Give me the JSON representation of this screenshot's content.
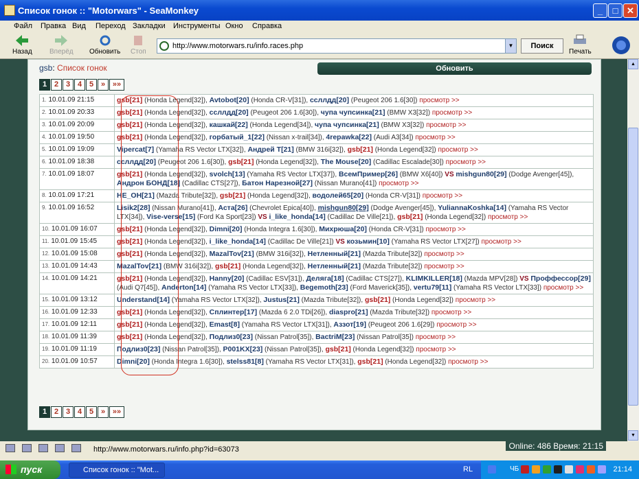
{
  "window": {
    "title": "Список гонок :: \"Motorwars\" - SeaMonkey",
    "buttons": [
      "_",
      "□",
      "✕"
    ]
  },
  "menu": [
    "Файл",
    "Правка",
    "Вид",
    "Переход",
    "Закладки",
    "Инструменты",
    "Окно",
    "Справка"
  ],
  "toolbar": {
    "back": "Назад",
    "forward": "Вперёд",
    "reload": "Обновить",
    "stop": "Стоп",
    "print": "Печать",
    "url": "http://www.motorwars.ru/info.races.php",
    "search": "Поиск"
  },
  "page": {
    "user": "gsb",
    "heading": "Список гонок",
    "refresh": "Обновить",
    "pager": [
      "1",
      "2",
      "3",
      "4",
      "5",
      "»",
      "»»"
    ],
    "view_label": "просмотр >>",
    "races": [
      {
        "num": "1.",
        "date": "10.01.09 21:15",
        "parts": [
          [
            "me",
            "gsb[21]"
          ],
          [
            "c",
            " (Honda Legend[32]), "
          ],
          [
            "p",
            "Avtobot[20]"
          ],
          [
            "c",
            " (Honda CR-V[31]), "
          ],
          [
            "p",
            "ссллдд[20]"
          ],
          [
            "c",
            " (Peugeot 206 1.6[30]) "
          ]
        ]
      },
      {
        "num": "2.",
        "date": "10.01.09 20:33",
        "parts": [
          [
            "me",
            "gsb[21]"
          ],
          [
            "c",
            " (Honda Legend[32]), "
          ],
          [
            "p",
            "ссллдд[20]"
          ],
          [
            "c",
            " (Peugeot 206 1.6[30]), "
          ],
          [
            "p",
            "чупа чупсинка[21]"
          ],
          [
            "c",
            " (BMW X3[32]) "
          ]
        ]
      },
      {
        "num": "3.",
        "date": "10.01.09 20:09",
        "parts": [
          [
            "me",
            "gsb[21]"
          ],
          [
            "c",
            " (Honda Legend[32]), "
          ],
          [
            "p",
            "кашкай[22]"
          ],
          [
            "c",
            " (Honda Legend[34]), "
          ],
          [
            "p",
            "чупа чупсинка[21]"
          ],
          [
            "c",
            " (BMW X3[32]) "
          ]
        ]
      },
      {
        "num": "4.",
        "date": "10.01.09 19:50",
        "parts": [
          [
            "me",
            "gsb[21]"
          ],
          [
            "c",
            " (Honda Legend[32]), "
          ],
          [
            "p",
            "горбатый_1[22]"
          ],
          [
            "c",
            " (Nissan x-trail[34]), "
          ],
          [
            "p",
            "4repawka[22]"
          ],
          [
            "c",
            " (Audi A3[34]) "
          ]
        ]
      },
      {
        "num": "5.",
        "date": "10.01.09 19:09",
        "parts": [
          [
            "p",
            "Vipercat[7]"
          ],
          [
            "c",
            " (Yamaha RS Vector LTX[32]), "
          ],
          [
            "p",
            "Андрей T[21]"
          ],
          [
            "c",
            " (BMW 316i[32]), "
          ],
          [
            "me",
            "gsb[21]"
          ],
          [
            "c",
            " (Honda Legend[32]) "
          ]
        ]
      },
      {
        "num": "6.",
        "date": "10.01.09 18:38",
        "parts": [
          [
            "p",
            "ссллдд[20]"
          ],
          [
            "c",
            " (Peugeot 206 1.6[30]), "
          ],
          [
            "me",
            "gsb[21]"
          ],
          [
            "c",
            " (Honda Legend[32]), "
          ],
          [
            "p",
            "The Mouse[20]"
          ],
          [
            "c",
            " (Cadillac Escalade[30]) "
          ]
        ]
      },
      {
        "num": "7.",
        "date": "10.01.09 18:07",
        "parts": [
          [
            "me",
            "gsb[21]"
          ],
          [
            "c",
            " (Honda Legend[32]), "
          ],
          [
            "p",
            "svolch[13]"
          ],
          [
            "c",
            " (Yamaha RS Vector LTX[37]), "
          ],
          [
            "p",
            "ВсемПример[26]"
          ],
          [
            "c",
            " (BMW X6[40]) "
          ],
          [
            "vs",
            "VS "
          ],
          [
            "p",
            "mishgun80[29]"
          ],
          [
            "c",
            " (Dodge Avenger[45]), "
          ],
          [
            "p",
            "Андрон БОНД[18]"
          ],
          [
            "c",
            " (Cadillac CTS[27]), "
          ],
          [
            "p",
            "Батон Нарезной[27]"
          ],
          [
            "c",
            " (Nissan Murano[41]) "
          ]
        ]
      },
      {
        "num": "8.",
        "date": "10.01.09 17:21",
        "parts": [
          [
            "p",
            "HE_OH[21]"
          ],
          [
            "c",
            " (Mazda Tribute[32]), "
          ],
          [
            "me",
            "gsb[21]"
          ],
          [
            "c",
            " (Honda Legend[32]), "
          ],
          [
            "p",
            "водолей65[20]"
          ],
          [
            "c",
            " (Honda CR-V[31]) "
          ]
        ]
      },
      {
        "num": "9.",
        "date": "10.01.09 16:52",
        "parts": [
          [
            "p",
            "Lisik2[28]"
          ],
          [
            "c",
            " (Nissan Murano[41]), "
          ],
          [
            "p",
            "Аста[26]"
          ],
          [
            "c",
            " (Chevrolet Epica[40]), "
          ],
          [
            "pu",
            "mishgun80[29]"
          ],
          [
            "c",
            " (Dodge Avenger[45]), "
          ],
          [
            "p",
            "YuliannaKoshka[14]"
          ],
          [
            "c",
            " (Yamaha RS Vector LTX[34]), "
          ],
          [
            "p",
            "Vise-verse[15]"
          ],
          [
            "c",
            " (Ford Ka Sport[23]) "
          ],
          [
            "vs",
            "VS "
          ],
          [
            "p",
            "i_like_honda[14]"
          ],
          [
            "c",
            " (Cadillac De Ville[21]), "
          ],
          [
            "me",
            "gsb[21]"
          ],
          [
            "c",
            " (Honda Legend[32]) "
          ]
        ]
      },
      {
        "num": "10.",
        "date": "10.01.09 16:07",
        "parts": [
          [
            "me",
            "gsb[21]"
          ],
          [
            "c",
            " (Honda Legend[32]), "
          ],
          [
            "p",
            "Dimni[20]"
          ],
          [
            "c",
            " (Honda Integra 1.6[30]), "
          ],
          [
            "p",
            "Михрюша[20]"
          ],
          [
            "c",
            " (Honda CR-V[31]) "
          ]
        ]
      },
      {
        "num": "11.",
        "date": "10.01.09 15:45",
        "parts": [
          [
            "me",
            "gsb[21]"
          ],
          [
            "c",
            " (Honda Legend[32]), "
          ],
          [
            "p",
            "i_like_honda[14]"
          ],
          [
            "c",
            " (Cadillac De Ville[21]) "
          ],
          [
            "vs",
            "VS "
          ],
          [
            "p",
            "козьмин[10]"
          ],
          [
            "c",
            " (Yamaha RS Vector LTX[27]) "
          ]
        ]
      },
      {
        "num": "12.",
        "date": "10.01.09 15:08",
        "parts": [
          [
            "me",
            "gsb[21]"
          ],
          [
            "c",
            " (Honda Legend[32]), "
          ],
          [
            "p",
            "MazalTov[21]"
          ],
          [
            "c",
            " (BMW 316i[32]), "
          ],
          [
            "p",
            "Нетленный[21]"
          ],
          [
            "c",
            " (Mazda Tribute[32]) "
          ]
        ]
      },
      {
        "num": "13.",
        "date": "10.01.09 14:43",
        "parts": [
          [
            "p",
            "MazalTov[21]"
          ],
          [
            "c",
            " (BMW 316i[32]), "
          ],
          [
            "me",
            "gsb[21]"
          ],
          [
            "c",
            " (Honda Legend[32]), "
          ],
          [
            "p",
            "Нетленный[21]"
          ],
          [
            "c",
            " (Mazda Tribute[32]) "
          ]
        ]
      },
      {
        "num": "14.",
        "date": "10.01.09 14:21",
        "parts": [
          [
            "me",
            "gsb[21]"
          ],
          [
            "c",
            " (Honda Legend[32]), "
          ],
          [
            "p",
            "Hanny[20]"
          ],
          [
            "c",
            " (Cadillac ESV[31]), "
          ],
          [
            "p",
            "Деляга[18]"
          ],
          [
            "c",
            " (Cadillac CTS[27]), "
          ],
          [
            "p",
            "KLIMKILLER[18]"
          ],
          [
            "c",
            " (Mazda MPV[28]) "
          ],
          [
            "vs",
            "VS "
          ],
          [
            "p",
            "Проффессор[29]"
          ],
          [
            "c",
            " (Audi Q7[45]), "
          ],
          [
            "p",
            "Anderton[14]"
          ],
          [
            "c",
            " (Yamaha RS Vector LTX[33]), "
          ],
          [
            "p",
            "Begemoth[23]"
          ],
          [
            "c",
            " (Ford Maverick[35]), "
          ],
          [
            "p",
            "vertu79[11]"
          ],
          [
            "c",
            " (Yamaha RS Vector LTX[33]) "
          ]
        ]
      },
      {
        "num": "15.",
        "date": "10.01.09 13:12",
        "parts": [
          [
            "p",
            "Understand[14]"
          ],
          [
            "c",
            " (Yamaha RS Vector LTX[32]), "
          ],
          [
            "p",
            "Justus[21]"
          ],
          [
            "c",
            " (Mazda Tribute[32]), "
          ],
          [
            "me",
            "gsb[21]"
          ],
          [
            "c",
            " (Honda Legend[32]) "
          ]
        ]
      },
      {
        "num": "16.",
        "date": "10.01.09 12:33",
        "parts": [
          [
            "me",
            "gsb[21]"
          ],
          [
            "c",
            " (Honda Legend[32]), "
          ],
          [
            "p",
            "Сплинтер[17]"
          ],
          [
            "c",
            " (Mazda 6 2.0 TDi[26]), "
          ],
          [
            "p",
            "diaspro[21]"
          ],
          [
            "c",
            " (Mazda Tribute[32]) "
          ]
        ]
      },
      {
        "num": "17.",
        "date": "10.01.09 12:11",
        "parts": [
          [
            "me",
            "gsb[21]"
          ],
          [
            "c",
            " (Honda Legend[32]), "
          ],
          [
            "p",
            "Emast[8]"
          ],
          [
            "c",
            " (Yamaha RS Vector LTX[31]), "
          ],
          [
            "p",
            "Аззот[19]"
          ],
          [
            "c",
            " (Peugeot 206 1.6[29]) "
          ]
        ]
      },
      {
        "num": "18.",
        "date": "10.01.09 11:39",
        "parts": [
          [
            "me",
            "gsb[21]"
          ],
          [
            "c",
            " (Honda Legend[32]), "
          ],
          [
            "p",
            "Подлиз0[23]"
          ],
          [
            "c",
            " (Nissan Patrol[35]), "
          ],
          [
            "p",
            "BactriM[23]"
          ],
          [
            "c",
            " (Nissan Patrol[35]) "
          ]
        ]
      },
      {
        "num": "19.",
        "date": "10.01.09 11:19",
        "parts": [
          [
            "p",
            "Подлиз0[23]"
          ],
          [
            "c",
            " (Nissan Patrol[35]), "
          ],
          [
            "p",
            "P001KX[23]"
          ],
          [
            "c",
            " (Nissan Patrol[35]), "
          ],
          [
            "me",
            "gsb[21]"
          ],
          [
            "c",
            " (Honda Legend[32]) "
          ]
        ]
      },
      {
        "num": "20.",
        "date": "10.01.09 10:57",
        "parts": [
          [
            "p",
            "Dimni[20]"
          ],
          [
            "c",
            " (Honda Integra 1.6[30]), "
          ],
          [
            "p",
            "stelss81[8]"
          ],
          [
            "c",
            " (Yamaha RS Vector LTX[31]), "
          ],
          [
            "me",
            "gsb[21]"
          ],
          [
            "c",
            " (Honda Legend[32]) "
          ]
        ]
      }
    ]
  },
  "status": {
    "online": "Online: 486  Время: 21:15",
    "url": "http://www.motorwars.ru/info.php?id=63073"
  },
  "taskbar": {
    "start": "пуск",
    "task": "Список гонок :: \"Mot...",
    "lang": "RL",
    "clock": "21:14",
    "tray_label": "ЧБ"
  }
}
